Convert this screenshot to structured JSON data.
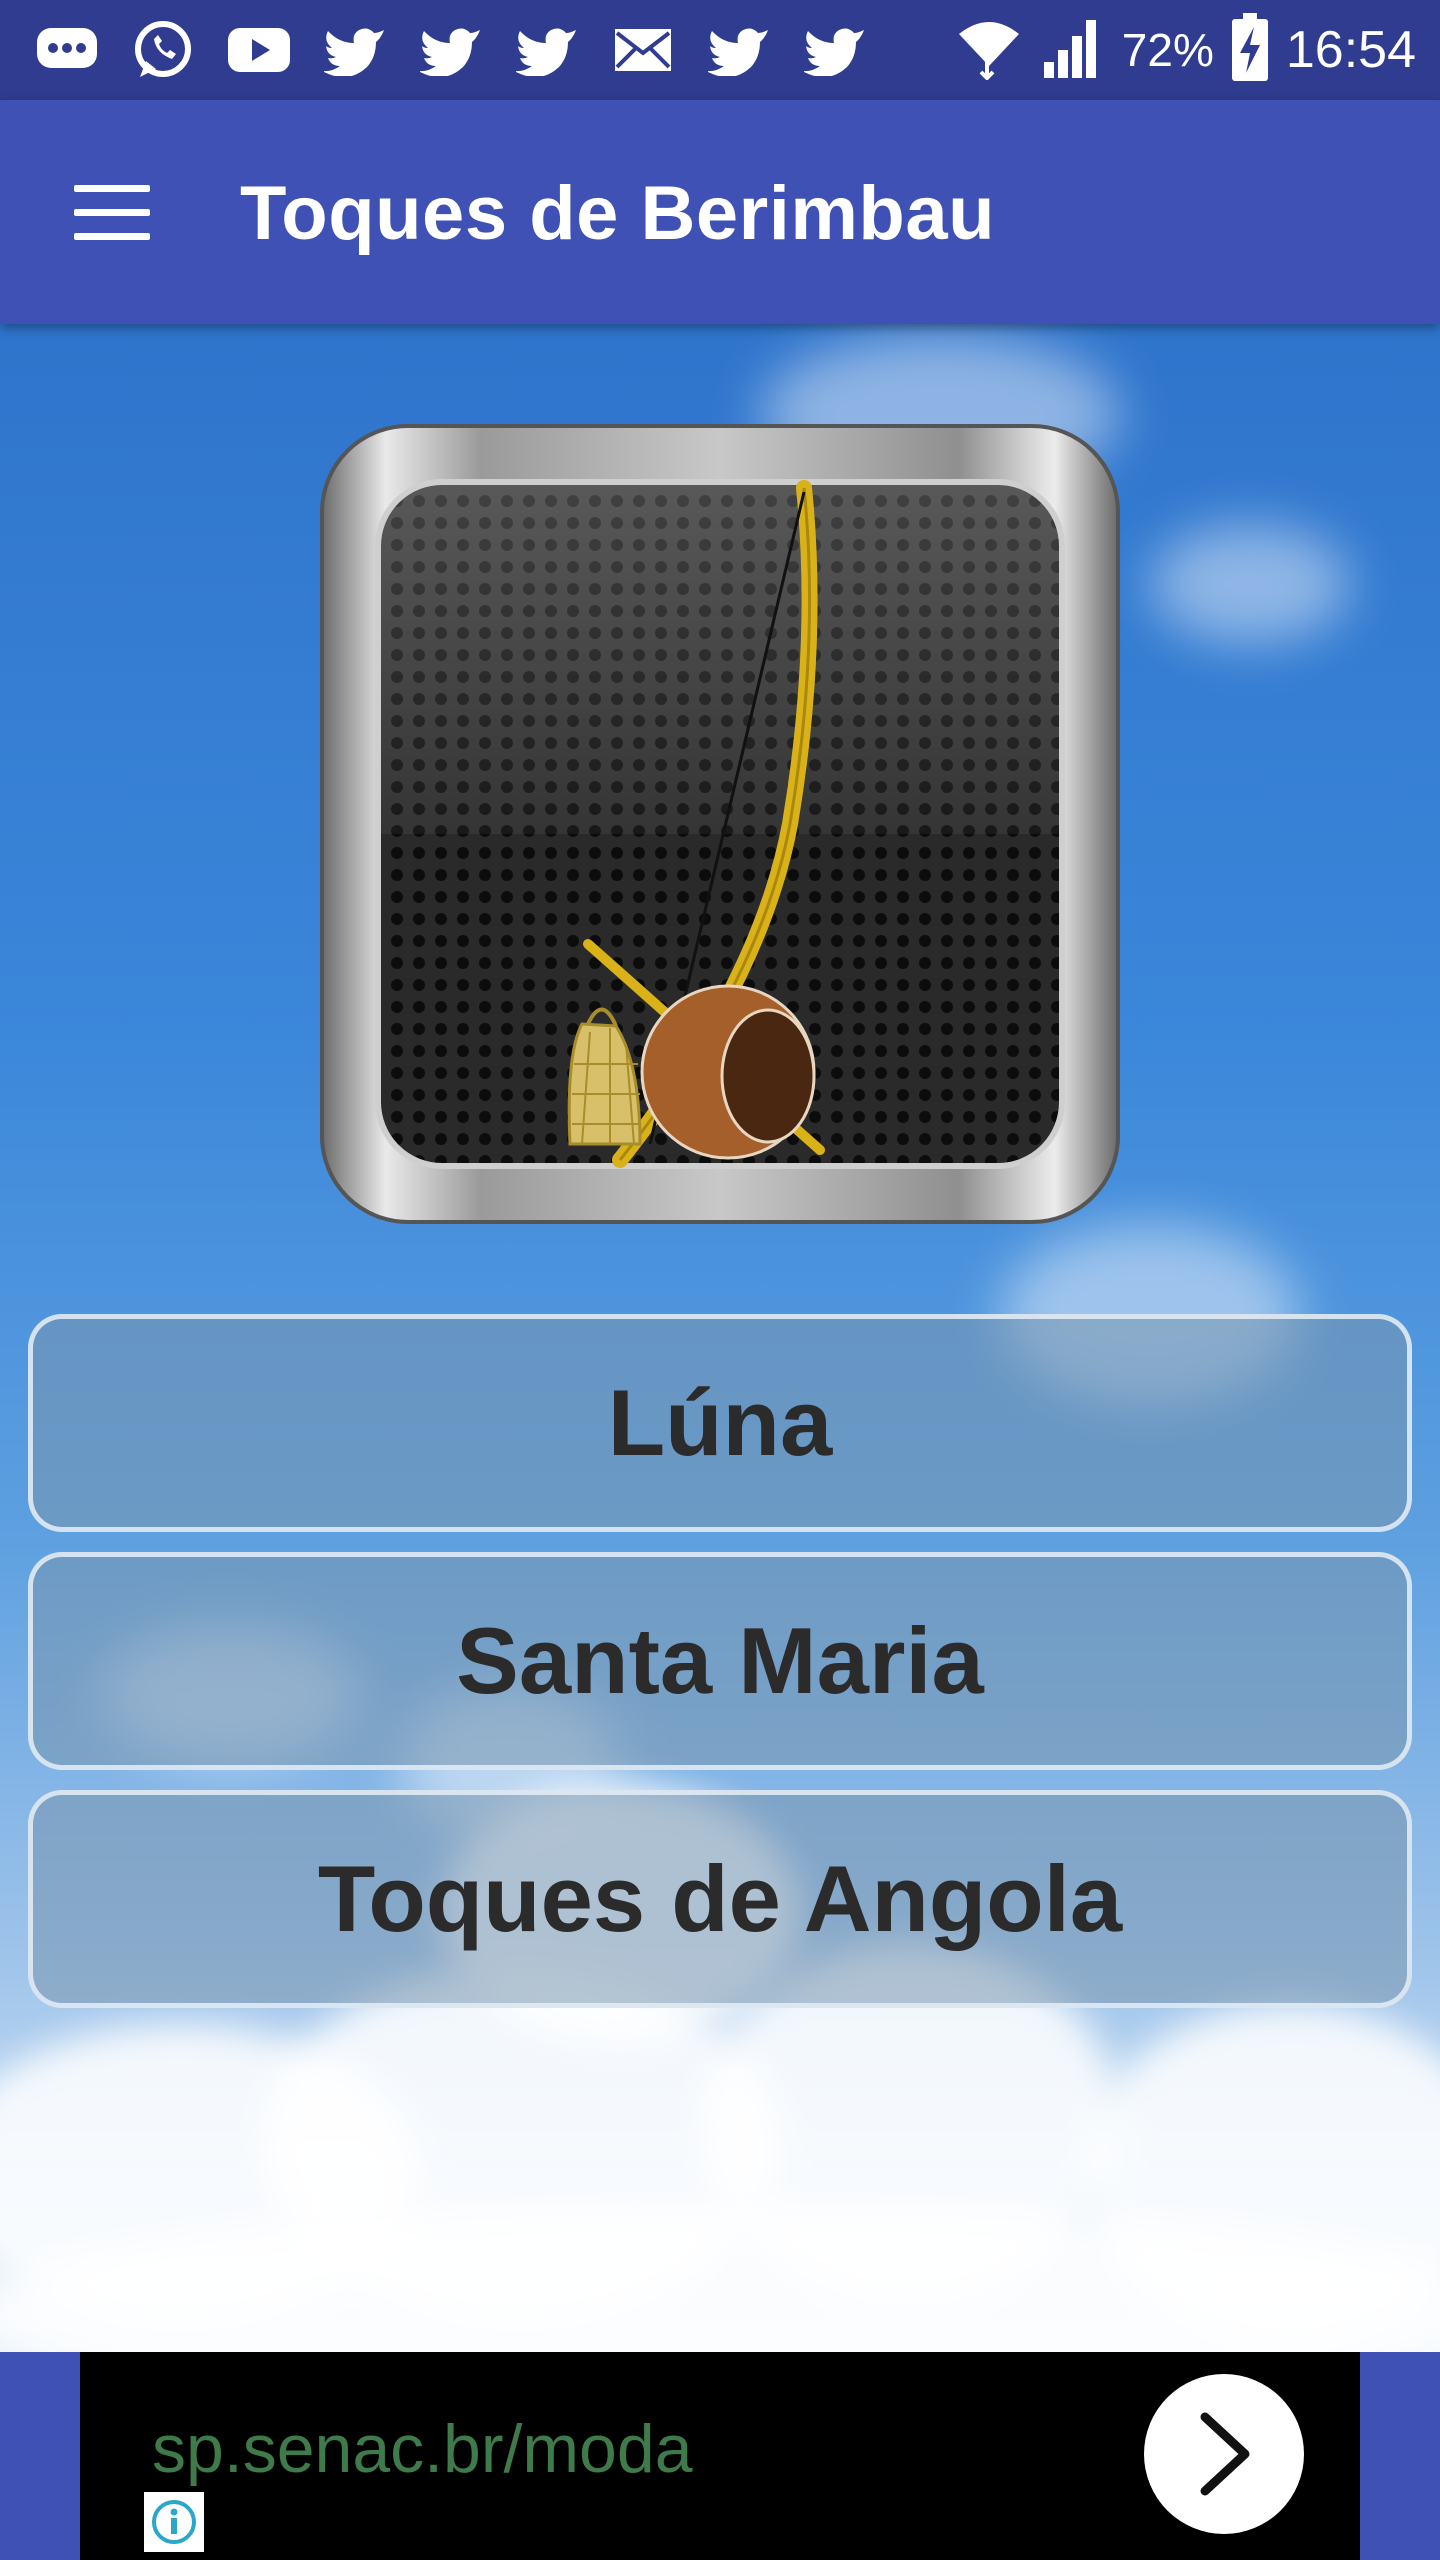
{
  "status_bar": {
    "battery_percent": "72%",
    "time": "16:54",
    "notification_icons": [
      "chat-bubble-icon",
      "whatsapp-icon",
      "youtube-icon",
      "twitter-icon",
      "twitter-icon",
      "twitter-icon",
      "mail-icon",
      "twitter-icon",
      "twitter-icon"
    ],
    "system_icons": [
      "wifi-icon",
      "signal-icon",
      "battery-charging-icon"
    ]
  },
  "app_bar": {
    "title": "Toques de Berimbau",
    "menu_icon": "hamburger-menu-icon"
  },
  "main": {
    "icon": "berimbau-app-icon",
    "buttons": [
      {
        "label": "Lúna"
      },
      {
        "label": "Santa Maria"
      },
      {
        "label": "Toques de Angola"
      }
    ]
  },
  "ad": {
    "url_text": "sp.senac.br/moda",
    "arrow_icon": "chevron-right-icon",
    "info_icon": "info-icon"
  },
  "colors": {
    "primary": "#3f51b5",
    "status_bar": "#2f3c8f",
    "button_text": "#2b2b2b",
    "ad_text": "#3f7a4a"
  }
}
